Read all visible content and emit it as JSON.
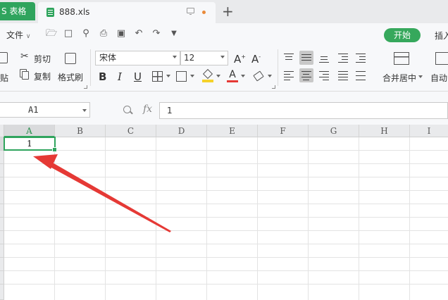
{
  "app": {
    "tab_label": "S 表格"
  },
  "document": {
    "tab_name": "888.xls"
  },
  "menu": {
    "file_label": "文件",
    "start_button": "开始",
    "insert_label": "插入"
  },
  "ribbon": {
    "cut": "剪切",
    "paste_partial": "贴",
    "copy": "复制",
    "format_painter": "格式刷",
    "font_name": "宋体",
    "font_size": "12",
    "merge_center": "合并居中",
    "auto_wrap": "自动"
  },
  "formula_bar": {
    "cell_ref": "A1",
    "fx_label": "fx",
    "content": "1"
  },
  "sheet": {
    "columns": [
      "A",
      "B",
      "C",
      "D",
      "E",
      "F",
      "G",
      "H",
      "I"
    ],
    "active_cell_value": "1"
  },
  "colors": {
    "accent": "#2fa45d",
    "arrow": "#e53935"
  }
}
